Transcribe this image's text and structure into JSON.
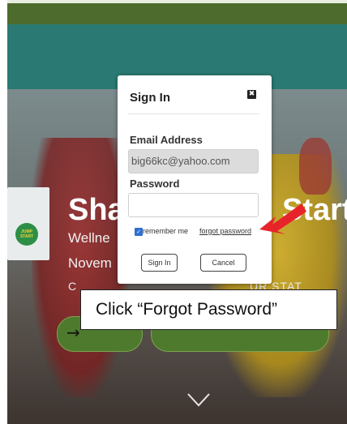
{
  "hero": {
    "title_left": "Sha",
    "title_right": "Start",
    "subtitle_line1": "Wellne",
    "subtitle_line2": "Novem",
    "subtitle_line3_left": "C",
    "subtitle_line3_right": "UR STAT",
    "logo_text": "JUMP START",
    "cta_left_icon": "arrow-right-icon"
  },
  "modal": {
    "title": "Sign In",
    "close_icon": "close-icon",
    "email_label": "Email Address",
    "email_value": "big66kc@yahoo.com",
    "password_label": "Password",
    "password_value": "",
    "remember_label": "remember me",
    "remember_checked": true,
    "forgot_label": "forgot password",
    "signin_label": "Sign In",
    "cancel_label": "Cancel"
  },
  "annotation": {
    "callout_text": "Click “Forgot Password”",
    "arrow_color": "#e8242b"
  },
  "colors": {
    "topbar": "#4d6b2c",
    "teal_band": "#2a7a73",
    "cta_green": "#4e7a2e",
    "checkbox_blue": "#2f6fd0"
  }
}
